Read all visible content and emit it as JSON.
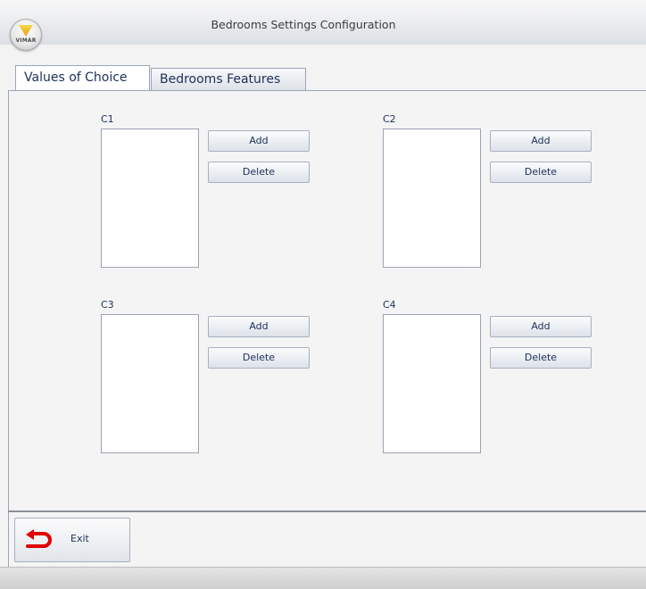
{
  "window": {
    "title": "Bedrooms Settings Configuration",
    "logo_text": "VIMAR"
  },
  "tabs": [
    {
      "label": "Values of Choice",
      "active": true
    },
    {
      "label": "Bedrooms Features",
      "active": false
    }
  ],
  "groups": [
    {
      "label": "C1",
      "add_label": "Add",
      "delete_label": "Delete",
      "items": []
    },
    {
      "label": "C2",
      "add_label": "Add",
      "delete_label": "Delete",
      "items": []
    },
    {
      "label": "C3",
      "add_label": "Add",
      "delete_label": "Delete",
      "items": []
    },
    {
      "label": "C4",
      "add_label": "Add",
      "delete_label": "Delete",
      "items": []
    }
  ],
  "footer": {
    "exit_label": "Exit",
    "exit_icon": "back-arrow-icon"
  },
  "colors": {
    "text": "#1e2f5a",
    "exit_icon": "#e00000"
  }
}
